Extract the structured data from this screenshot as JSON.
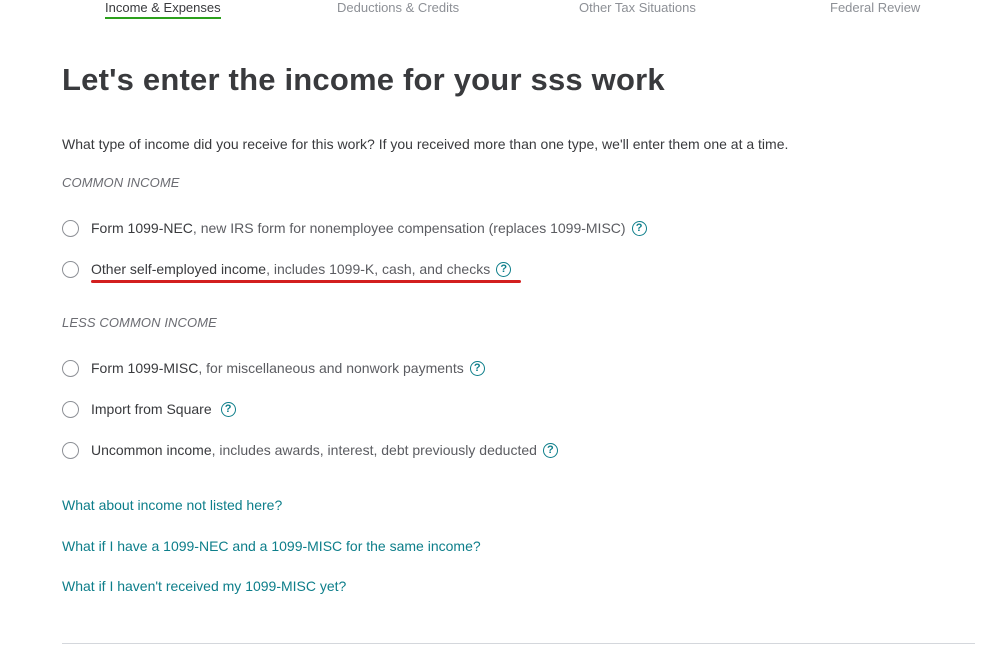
{
  "tabs": [
    {
      "label": "Income & Expenses",
      "active": true
    },
    {
      "label": "Deductions & Credits",
      "active": false
    },
    {
      "label": "Other Tax Situations",
      "active": false
    },
    {
      "label": "Federal Review",
      "active": false
    }
  ],
  "heading": "Let's enter the income for your sss work",
  "question": "What type of income did you receive for this work? If you received more than one type, we'll enter them one at a time.",
  "sections": {
    "common_label": "COMMON INCOME",
    "less_common_label": "LESS COMMON INCOME"
  },
  "options": [
    {
      "main": "Form 1099-NEC",
      "sub": ", new IRS form for nonemployee compensation (replaces 1099-MISC)",
      "help": "?"
    },
    {
      "main": "Other self-employed income",
      "sub": ", includes 1099-K, cash, and checks",
      "help": "?"
    },
    {
      "main": "Form 1099-MISC",
      "sub": ", for miscellaneous and nonwork payments",
      "help": "?"
    },
    {
      "main": "Import from Square",
      "sub": "",
      "help": "?"
    },
    {
      "main": "Uncommon income",
      "sub": ", includes awards, interest, debt previously deducted",
      "help": "?"
    }
  ],
  "links": [
    "What about income not listed here?",
    "What if I have a 1099-NEC and a 1099-MISC for the same income?",
    "What if I haven't received my 1099-MISC yet?"
  ],
  "colors": {
    "link": "#0d7e8a",
    "active_tab_underline": "#2ca01c",
    "annotation_underline": "#d31f1f"
  },
  "icons": {
    "help": "question-circle-icon",
    "radio": "radio-button"
  }
}
